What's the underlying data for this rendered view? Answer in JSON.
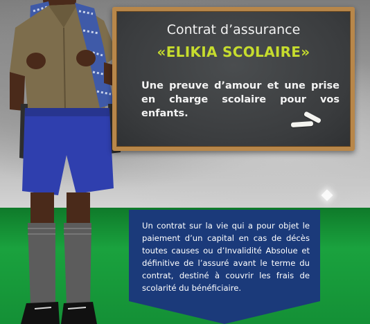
{
  "board": {
    "title_line1": "Contrat d’assurance",
    "title_line2": "«ELIKIA SCOLAIRE»",
    "tagline": "Une preuve d’amour et une prise en charge scolaire pour vos enfants."
  },
  "panel": {
    "description": "Un contrat sur la vie qui a pour objet le paiement d’un capital en cas de décès toutes causes ou d’Invalidité Absolue et définitive de l’assuré avant le terme du contrat, destiné à couvrir les frais de scolarité du bénéficiaire."
  },
  "colors": {
    "board_background": "#3a3c3e",
    "board_frame": "#b8874a",
    "title_accent": "#c6dc2e",
    "panel_blue": "#1b3a7a",
    "green_band": "#149036"
  }
}
